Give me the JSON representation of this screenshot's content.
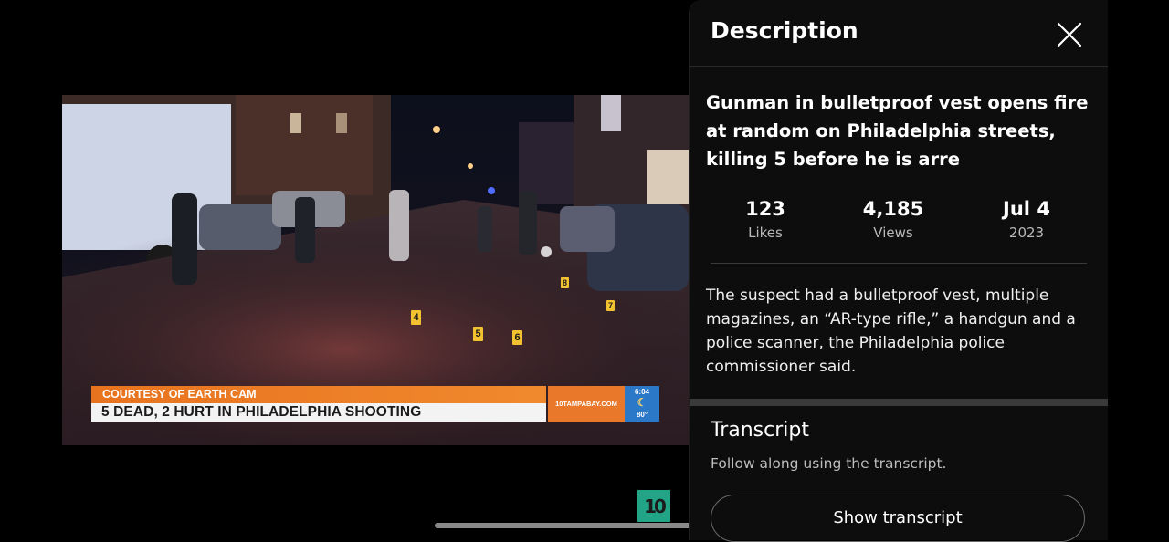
{
  "video": {
    "lower_third": {
      "top_line": "COURTESY OF EARTH CAM",
      "headline": "5 DEAD, 2 HURT IN PHILADELPHIA SHOOTING",
      "brand": "10TAMPABAY.COM",
      "time": "6:04",
      "temperature": "80°"
    },
    "markers": [
      "4",
      "5",
      "6",
      "8",
      "7"
    ],
    "channel_logo": "10"
  },
  "panel": {
    "title": "Description",
    "video_title": "Gunman in bulletproof vest opens fire at random on Philadelphia streets, killing 5 before he is arre",
    "stats": [
      {
        "value": "123",
        "label": "Likes"
      },
      {
        "value": "4,185",
        "label": "Views"
      },
      {
        "value": "Jul 4",
        "label": "2023"
      }
    ],
    "description": "The suspect had a bulletproof vest, multiple magazines, an “AR-type rifle,” a handgun and a police scanner, the Philadelphia police commissioner said.",
    "transcript": {
      "title": "Transcript",
      "subtitle": "Follow along using the transcript.",
      "button_label": "Show transcript"
    }
  },
  "colors": {
    "panel_bg": "#0d0d0d",
    "lower_third_orange": "#e8731f",
    "clock_blue": "#2b78c8",
    "marker_yellow": "#f2c230",
    "logo_green": "#22a487"
  }
}
